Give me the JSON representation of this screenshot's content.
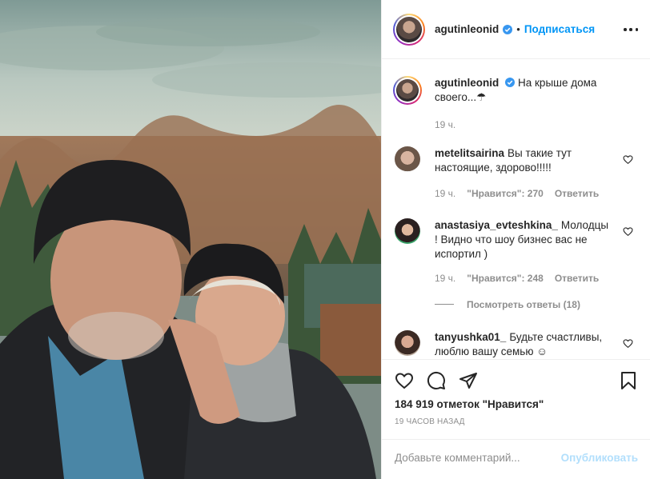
{
  "post": {
    "username": "agutinleonid",
    "follow_label": "Подписаться",
    "separator": "•",
    "caption": "На крыше дома своего...☂",
    "caption_time": "19 ч."
  },
  "comments": [
    {
      "username": "metelitsairina",
      "text": "Вы такие тут настоящие, здорово!!!!!",
      "time": "19 ч.",
      "likes": "\"Нравится\": 270",
      "reply": "Ответить"
    },
    {
      "username": "anastasiya_evteshkina_",
      "text": "Молодцы ! Видно что шоу бизнес вас не испортил )",
      "time": "19 ч.",
      "likes": "\"Нравится\": 248",
      "reply": "Ответить",
      "view_replies": "Посмотреть ответы (18)"
    },
    {
      "username": "tanyushka01_",
      "text": "Будьте счастливы, люблю вашу семью ☺"
    }
  ],
  "actions": {
    "likes_count": "184 919 отметок \"Нравится\"",
    "time_ago": "19 ЧАСОВ НАЗАД"
  },
  "add_comment": {
    "placeholder": "Добавьте комментарий...",
    "publish_label": "Опубликовать"
  },
  "icons": [
    "heart-icon",
    "comment-icon",
    "share-icon",
    "bookmark-icon",
    "more-icon",
    "verified-icon"
  ],
  "colors": {
    "link_blue": "#0095f6",
    "publish_disabled": "#b2dffc",
    "verified_blue": "#3897f0",
    "muted": "#8e8e8e"
  }
}
